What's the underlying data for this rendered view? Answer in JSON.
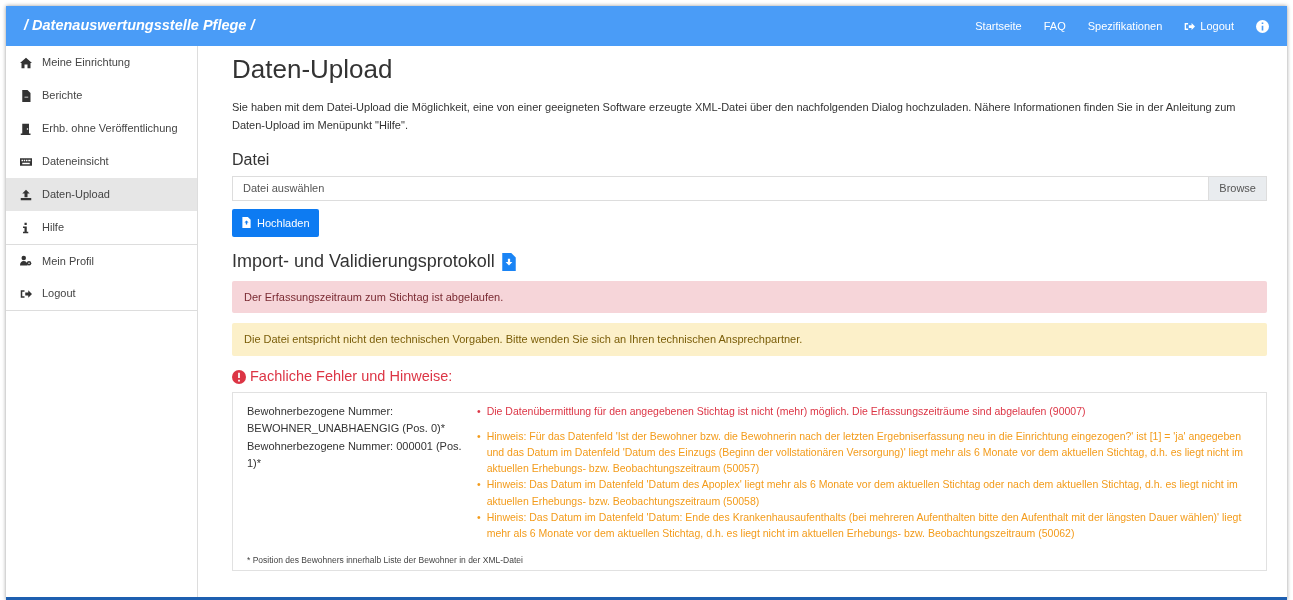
{
  "navbar": {
    "brand": "/ Datenauswertungsstelle Pflege /",
    "links": [
      {
        "label": "Startseite",
        "kind": "text"
      },
      {
        "label": "FAQ",
        "kind": "text"
      },
      {
        "label": "Spezifikationen",
        "kind": "text"
      },
      {
        "label": "Logout",
        "kind": "logout"
      },
      {
        "kind": "info"
      }
    ]
  },
  "sidebar": {
    "items": [
      {
        "label": "Meine Einrichtung",
        "selected": false
      },
      {
        "label": "Berichte",
        "selected": false
      },
      {
        "label": "Erhb. ohne Veröffentlichung",
        "selected": false
      },
      {
        "label": "Dateneinsicht",
        "selected": false
      },
      {
        "label": "Daten-Upload",
        "selected": true
      },
      {
        "label": "Hilfe",
        "selected": false
      },
      {
        "label": "Mein Profil",
        "selected": false
      },
      {
        "label": "Logout",
        "selected": false
      }
    ]
  },
  "page": {
    "title": "Daten-Upload",
    "intro": "Sie haben mit dem Datei-Upload die Möglichkeit, eine von einer geeigneten Software erzeugte XML-Datei über den nachfolgenden Dialog hochzuladen. Nähere Informationen finden Sie in der Anleitung zum Daten-Upload im Menüpunkt \"Hilfe\".",
    "file_label": "Datei",
    "file_input": {
      "placeholder": "Datei auswählen",
      "browse": "Browse"
    },
    "upload_button": "Hochladen"
  },
  "protocol": {
    "title": "Import- und Validierungsprotokoll",
    "alerts": [
      {
        "kind": "danger",
        "text": "Der Erfassungszeitraum zum Stichtag ist abgelaufen."
      },
      {
        "kind": "warning",
        "text": "Die Datei entspricht nicht den technischen Vorgaben. Bitte wenden Sie sich an Ihren technischen Ansprechpartner."
      }
    ],
    "issues_title": "Fachliche Fehler und Hinweise:",
    "groups": [
      {
        "resident": "Bewohnerbezogene Nummer: BEWOHNER_UNABHAENGIG (Pos. 0)*",
        "messages": [
          {
            "kind": "error",
            "marker": "•",
            "text": "Die Datenübermittlung für den angegebenen Stichtag ist nicht (mehr) möglich. Die Erfassungszeiträume sind abgelaufen (90007)"
          }
        ]
      },
      {
        "resident": "Bewohnerbezogene Nummer: 000001 (Pos. 1)*",
        "messages": [
          {
            "kind": "hint",
            "marker": "•",
            "text": "Hinweis: Für das Datenfeld 'Ist der Bewohner bzw. die Bewohnerin nach der letzten Ergebniserfassung neu in die Einrichtung eingezogen?' ist [1] = 'ja' angegeben und das Datum im Datenfeld 'Datum des Einzugs (Beginn der vollstationären Versorgung)' liegt mehr als 6 Monate vor dem aktuellen Stichtag, d.h. es liegt nicht im aktuellen Erhebungs- bzw. Beobachtungszeitraum (50057)"
          },
          {
            "kind": "hint",
            "marker": "•",
            "text": "Hinweis: Das Datum im Datenfeld 'Datum des Apoplex' liegt mehr als 6 Monate vor dem aktuellen Stichtag oder nach dem aktuellen Stichtag, d.h. es liegt nicht im aktuellen Erhebungs- bzw. Beobachtungszeitraum (50058)"
          },
          {
            "kind": "hint",
            "marker": "•",
            "text": "Hinweis: Das Datum im Datenfeld 'Datum: Ende des Krankenhausaufenthalts (bei mehreren Aufenthalten bitte den Aufenthalt mit der längsten Dauer wählen)' liegt mehr als 6 Monate vor dem aktuellen Stichtag, d.h. es liegt nicht im aktuellen Erhebungs- bzw. Beobachtungszeitraum (50062)"
          }
        ]
      }
    ],
    "footnote": "* Position des Bewohners innerhalb Liste der Bewohner in der XML-Datei"
  }
}
